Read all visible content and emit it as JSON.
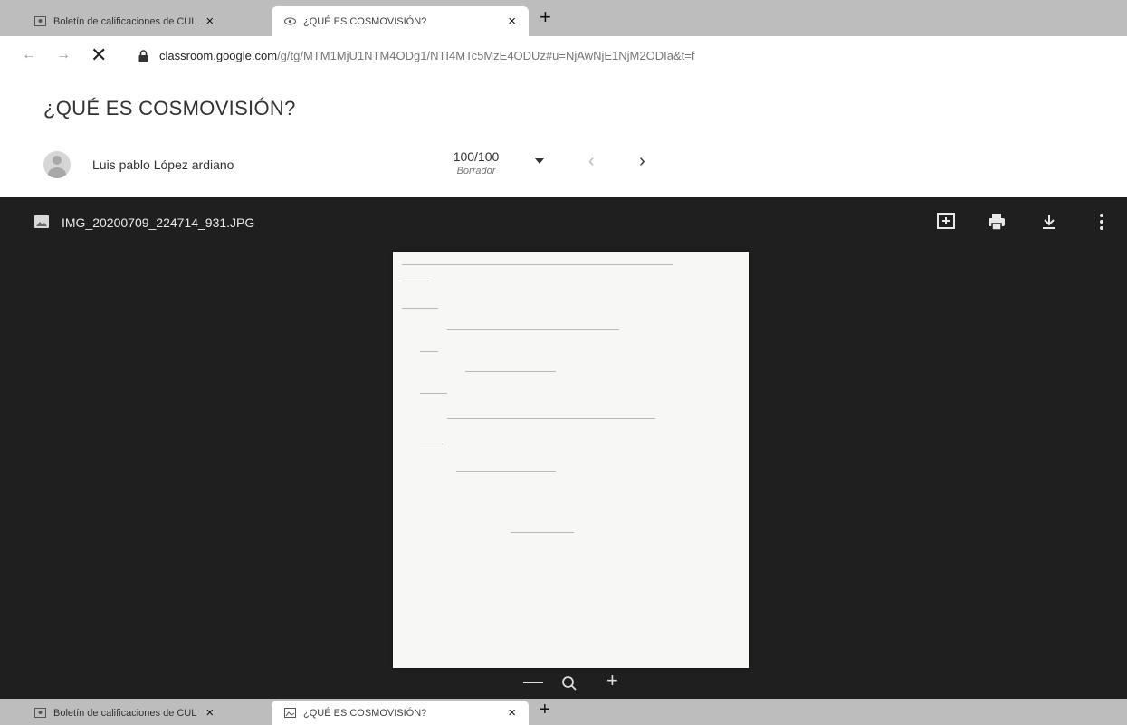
{
  "browser": {
    "tabs": [
      {
        "label": "Boletín de calificaciones de CUL",
        "active": false
      },
      {
        "label": "¿QUÉ ES COSMOVISIÓN?",
        "active": true
      }
    ],
    "tab_close_glyph": "×",
    "new_tab_glyph": "+",
    "nav": {
      "back_glyph": "←",
      "forward_glyph": "→",
      "stop_glyph": "✕"
    },
    "url_host": "classroom.google.com",
    "url_path": "/g/tg/MTM1MjU1NTM4ODg1/NTI4MTc5MzE4ODUz#u=NjAwNjE1NjM2ODIa&t=f"
  },
  "page": {
    "title": "¿QUÉ ES COSMOVISIÓN?"
  },
  "student": {
    "name": "Luis pablo López ardiano",
    "grade": "100/100",
    "grade_status": "Borrador",
    "prev_glyph": "‹",
    "next_glyph": "›"
  },
  "viewer": {
    "file_name": "IMG_20200709_224714_931.JPG",
    "tools": [
      "add-comment-icon",
      "print-icon",
      "download-icon",
      "more-vert-icon"
    ],
    "zoom": {
      "out_glyph": "—",
      "in_glyph": "+"
    }
  },
  "colors": {
    "viewer_bg": "#1f1f1f",
    "tabstrip_bg": "#bdbdbd",
    "page_bg": "#ffffff"
  }
}
